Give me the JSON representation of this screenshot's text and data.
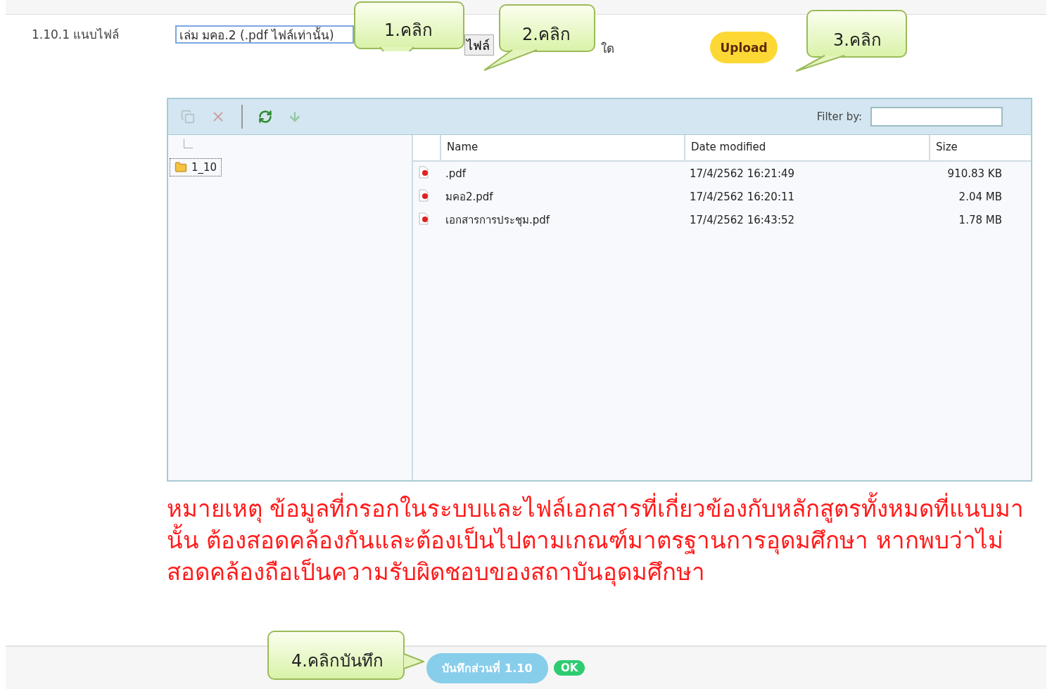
{
  "attach_row": {
    "label": "1.10.1 แนบไฟล์",
    "field_value": "เล่ม มคอ.2 (.pdf ไฟล์เท่านั้น)",
    "file_button": "ไฟล์",
    "file_status": "ใด",
    "upload_button": "Upload"
  },
  "callouts": [
    {
      "text": "1.คลิก"
    },
    {
      "text": "2.คลิก"
    },
    {
      "text": "3.คลิก"
    },
    {
      "text": "4.คลิกบันทึก"
    }
  ],
  "file_manager": {
    "toolbar": [
      {
        "kind": "copy",
        "disabled": true
      },
      {
        "kind": "delete",
        "disabled": true
      },
      {
        "kind": "separator"
      },
      {
        "kind": "refresh",
        "disabled": false
      },
      {
        "kind": "download",
        "disabled": true
      }
    ],
    "filter_label": "Filter by:",
    "tree": [
      {
        "label": "1_10",
        "selected": true
      }
    ],
    "columns": [
      "Name",
      "Date modified",
      "Size"
    ],
    "rows": [
      {
        "name": ".pdf",
        "date": "17/4/2562 16:21:49",
        "size": "910.83 KB"
      },
      {
        "name": "มคอ2.pdf",
        "date": "17/4/2562 16:20:11",
        "size": "2.04 MB"
      },
      {
        "name": "เอกสารการประชุม.pdf",
        "date": "17/4/2562 16:43:52",
        "size": "1.78 MB"
      }
    ]
  },
  "note": "หมายเหตุ ข้อมูลที่กรอกในระบบและไฟล์เอกสารที่เกี่ยวข้องกับหลักสูตรทั้งหมดที่แนบมานั้น ต้องสอดคล้องกันและต้องเป็นไปตามเกณฑ์มาตรฐานการอุดมศึกษา หากพบว่าไม่สอดคล้องถือเป็นความรับผิดชอบของสถาบันอุดมศึกษา",
  "footer": {
    "save_button": "บันทึกส่วนที่ 1.10",
    "ok_badge": "OK"
  }
}
